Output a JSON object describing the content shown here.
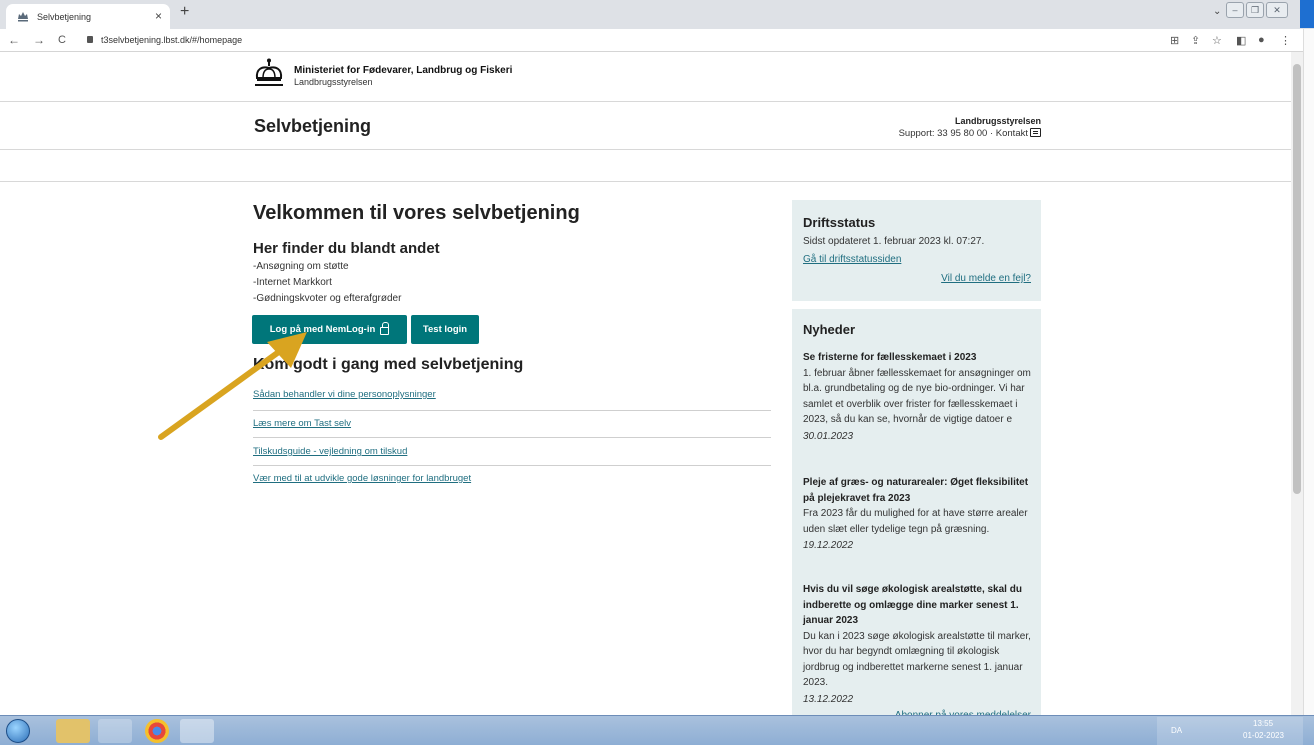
{
  "browser": {
    "tab_title": "Selvbetjening",
    "tab_close": "×",
    "new_tab": "+",
    "url": "t3selvbetjening.lbst.dk/#/homepage",
    "back": "←",
    "forward": "→",
    "reload": "C"
  },
  "header": {
    "ministry": "Ministeriet for Fødevarer, Landbrug og Fiskeri",
    "agency": "Landbrugsstyrelsen",
    "site_title": "Selvbetjening",
    "right_title": "Landbrugsstyrelsen",
    "support": "Support: 33 95 80 00 · Kontakt"
  },
  "main": {
    "welcome": "Velkommen til vores selvbetjening",
    "subhead": "Her finder du blandt andet",
    "items": [
      "-Ansøgning om støtte",
      "-Internet Markkort",
      "-Gødningskvoter og efterafgrøder"
    ],
    "login_button": "Log på med NemLog-in",
    "test_button": "Test login",
    "getstarted": "Kom godt i gang med selvbetjening",
    "links": [
      "Sådan behandler vi dine personoplysninger",
      "Læs mere om Tast selv",
      "Tilskudsguide - vejledning om tilskud",
      "Vær med til at udvikle gode løsninger for landbruget"
    ]
  },
  "status": {
    "title": "Driftsstatus",
    "updated": "Sidst opdateret 1. februar 2023 kl. 07:27.",
    "link1": "Gå til driftsstatussiden",
    "link2": "Vil du melde en fejl?"
  },
  "news": {
    "title": "Nyheder",
    "items": [
      {
        "headline": "Se fristerne for fællesskemaet i 2023",
        "body": "1. februar åbner fællesskemaet for ansøgninger om bl.a. grundbetaling og de nye bio-ordninger. Vi har samlet et overblik over frister for fællesskemaet i 2023, så du kan se, hvornår de vigtige datoer e",
        "date": "30.01.2023"
      },
      {
        "headline": "Pleje af græs- og naturarealer: Øget fleksibilitet på plejekravet fra 2023",
        "body": "Fra 2023 får du mulighed for at have større arealer uden slæt eller tydelige tegn på græsning.",
        "date": "19.12.2022"
      },
      {
        "headline": "Hvis du vil søge økologisk arealstøtte, skal du indberette og omlægge dine marker senest 1. januar 2023",
        "body": "Du kan i 2023 søge økologisk arealstøtte til marker, hvor du har begyndt omlægning til økologisk jordbrug og indberettet markerne senest 1. januar 2023.",
        "date": "13.12.2022"
      }
    ],
    "subscribe": "Abonner på vores meddelelser"
  },
  "taskbar": {
    "lang": "DA",
    "time": "13:55",
    "date": "01-02-2023"
  },
  "colors": {
    "button": "#00767a",
    "card": "#e5eeef",
    "link": "#1f6e80",
    "arrow": "#d9a420"
  }
}
